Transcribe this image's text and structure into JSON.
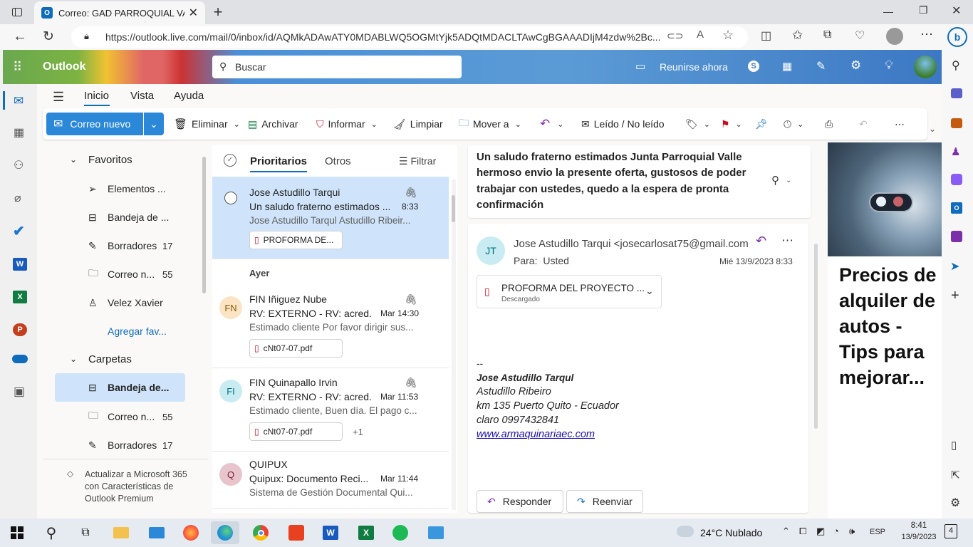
{
  "browser": {
    "tab_title": "Correo: GAD PARROQUIAL VALLE",
    "url": "https://outlook.live.com/mail/0/inbox/id/AQMkADAwATY0MDABLWQ5OGMtYjk5ADQtMDACLTAwCgBGAAADIjM4zdw%2Bc..."
  },
  "outlook": {
    "app_name": "Outlook",
    "search_placeholder": "Buscar",
    "meet_now": "Reunirse ahora",
    "menu_tabs": [
      "Inicio",
      "Vista",
      "Ayuda"
    ],
    "ribbon": {
      "new_mail": "Correo nuevo",
      "delete": "Eliminar",
      "archive": "Archivar",
      "report": "Informar",
      "sweep": "Limpiar",
      "move_to": "Mover a",
      "read_unread": "Leído / No leído"
    },
    "folders": {
      "favorites_header": "Favoritos",
      "folders_header": "Carpetas",
      "favorites": [
        {
          "label": "Elementos ...",
          "count": ""
        },
        {
          "label": "Bandeja de ...",
          "count": ""
        },
        {
          "label": "Borradores",
          "count": "17"
        },
        {
          "label": "Correo n...",
          "count": "55"
        },
        {
          "label": "Velez Xavier",
          "count": ""
        }
      ],
      "add_favorite": "Agregar fav...",
      "folder_items": [
        {
          "label": "Bandeja de...",
          "count": ""
        },
        {
          "label": "Correo n...",
          "count": "55"
        },
        {
          "label": "Borradores",
          "count": "17"
        }
      ],
      "premium_text": "Actualizar a Microsoft 365 con Características de Outlook Premium"
    },
    "message_list": {
      "tab_focused": "Prioritarios",
      "tab_other": "Otros",
      "filter": "Filtrar",
      "group_yesterday": "Ayer",
      "messages": [
        {
          "initials": "",
          "sender": "Jose Astudillo Tarqui",
          "subject": "Un saludo fraterno estimados ...",
          "time": "8:33",
          "preview": "Jose Astudillo Tarqul Astudillo Ribeir...",
          "attachment": "PROFORMA DE...",
          "extra": ""
        },
        {
          "initials": "FN",
          "sender": "FIN Iñiguez Nube",
          "subject": "RV: EXTERNO - RV: acred...",
          "time": "Mar 14:30",
          "preview": "Estimado cliente Por favor dirigir sus...",
          "attachment": "cNt07-07.pdf",
          "extra": ""
        },
        {
          "initials": "FI",
          "sender": "FIN Quinapallo Irvin",
          "subject": "RV: EXTERNO - RV: acred...",
          "time": "Mar 11:53",
          "preview": "Estimado cliente, Buen día. El pago c...",
          "attachment": "cNt07-07.pdf",
          "extra": "+1"
        },
        {
          "initials": "Q",
          "sender": "QUIPUX",
          "subject": "Quipux: Documento Reci...",
          "time": "Mar 11:44",
          "preview": "Sistema de Gestión Documental Qui...",
          "attachment": "",
          "extra": ""
        }
      ]
    },
    "reading": {
      "subject": "Un saludo fraterno estimados Junta Parroquial Valle hermoso envio la presente oferta, gustosos de poder trabajar con ustedes, quedo a la espera de pronta confirmación",
      "sender_initials": "JT",
      "sender": "Jose Astudillo Tarqui <josecarlosat75@gmail.com>",
      "to_label": "Para:",
      "to_value": "Usted",
      "date": "Mié 13/9/2023 8:33",
      "attachment_name": "PROFORMA DEL PROYECTO ...",
      "attachment_status": "Descargado",
      "signature_dash": "--",
      "signature_name": "Jose Astudillo Tarqul",
      "signature_line2": "Astudillo Ribeiro",
      "signature_line3": "km 135 Puerto Quito - Ecuador",
      "signature_line4": "claro 0997432841",
      "signature_link": "www.armaquinariaec.com",
      "reply": "Responder",
      "forward": "Reenviar"
    },
    "ad_text": "Precios de alquiler de autos - Tips para mejorar..."
  },
  "taskbar": {
    "weather": "24°C  Nublado",
    "language": "ESP",
    "time": "8:41",
    "date": "13/9/2023",
    "notification_count": "4"
  },
  "colors": {
    "accent": "#0f6cbd",
    "selected_bg": "#cfe4fa",
    "ribbon_new_mail": "#2b88d8"
  }
}
